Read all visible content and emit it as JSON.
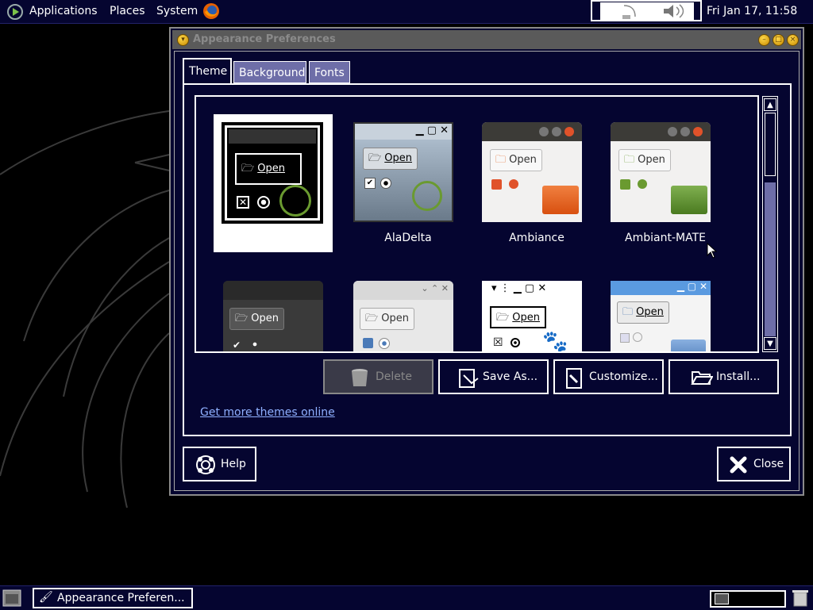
{
  "top_panel": {
    "menus": [
      "Applications",
      "Places",
      "System"
    ],
    "clock": "Fri Jan 17, 11:58"
  },
  "window": {
    "title": "Appearance Preferences",
    "tabs": [
      {
        "label": "Theme",
        "active": true
      },
      {
        "label": "Background",
        "active": false
      },
      {
        "label": "Fonts",
        "active": false
      }
    ],
    "themes": [
      {
        "name": "",
        "selected": true,
        "preview_button": "Open"
      },
      {
        "name": "AlaDelta",
        "selected": false,
        "preview_button": "Open"
      },
      {
        "name": "Ambiance",
        "selected": false,
        "preview_button": "Open"
      },
      {
        "name": "Ambiant-MATE",
        "selected": false,
        "preview_button": "Open"
      },
      {
        "name": "",
        "selected": false,
        "preview_button": "Open"
      },
      {
        "name": "",
        "selected": false,
        "preview_button": "Open"
      },
      {
        "name": "",
        "selected": false,
        "preview_button": "Open"
      },
      {
        "name": "",
        "selected": false,
        "preview_button": "Open"
      }
    ],
    "buttons": {
      "delete": "Delete",
      "save_as": "Save As...",
      "customize": "Customize...",
      "install": "Install..."
    },
    "link": "Get more themes online",
    "help": "Help",
    "close": "Close"
  },
  "bottom_panel": {
    "task": "Appearance Preferen..."
  },
  "colors": {
    "panel": "#050530",
    "accent": "#6e6ea8",
    "link": "#8fb0ff",
    "desktop": "#000000"
  }
}
